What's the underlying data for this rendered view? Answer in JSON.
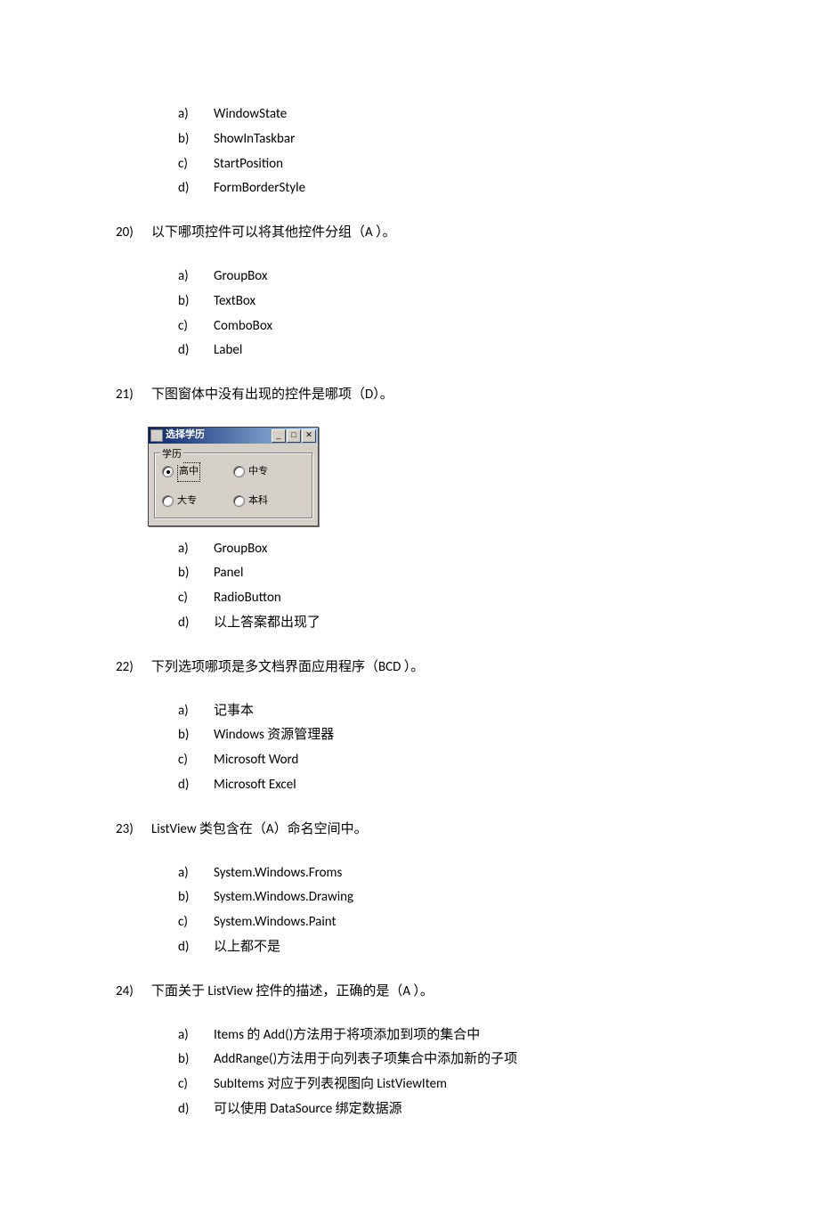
{
  "q19": {
    "options": [
      {
        "letter": "a)",
        "text": "WindowState"
      },
      {
        "letter": "b)",
        "text": "ShowInTaskbar"
      },
      {
        "letter": "c)",
        "text": "StartPosition"
      },
      {
        "letter": "d)",
        "text": "FormBorderStyle"
      }
    ]
  },
  "q20": {
    "num": "20)",
    "text": "以下哪项控件可以将其他控件分组（A   ）。",
    "options": [
      {
        "letter": "a)",
        "text": "GroupBox"
      },
      {
        "letter": "b)",
        "text": "TextBox"
      },
      {
        "letter": "c)",
        "text": "ComboBox"
      },
      {
        "letter": "d)",
        "text": "Label"
      }
    ]
  },
  "q21": {
    "num": "21)",
    "text": "下图窗体中没有出现的控件是哪项（D）。",
    "dialog": {
      "title": "选择学历",
      "groupbox_title": "学历",
      "radios": [
        {
          "label": "高中",
          "checked": true
        },
        {
          "label": "中专",
          "checked": false
        },
        {
          "label": "大专",
          "checked": false
        },
        {
          "label": "本科",
          "checked": false
        }
      ]
    },
    "options": [
      {
        "letter": "a)",
        "text": "GroupBox"
      },
      {
        "letter": "b)",
        "text": "Panel"
      },
      {
        "letter": "c)",
        "text": "RadioButton"
      },
      {
        "letter": "d)",
        "text": "以上答案都出现了"
      }
    ]
  },
  "q22": {
    "num": "22)",
    "text": "下列选项哪项是多文档界面应用程序（BCD   ）。",
    "options": [
      {
        "letter": "a)",
        "text": "记事本"
      },
      {
        "letter": "b)",
        "text": "Windows 资源管理器"
      },
      {
        "letter": "c)",
        "text": "Microsoft Word"
      },
      {
        "letter": "d)",
        "text": "Microsoft Excel"
      }
    ]
  },
  "q23": {
    "num": "23)",
    "text": "ListView 类包含在（A）命名空间中。",
    "options": [
      {
        "letter": "a)",
        "text": "System.Windows.Froms"
      },
      {
        "letter": "b)",
        "text": "System.Windows.Drawing"
      },
      {
        "letter": "c)",
        "text": "System.Windows.Paint"
      },
      {
        "letter": "d)",
        "text": "以上都不是"
      }
    ]
  },
  "q24": {
    "num": "24)",
    "text": "下面关于 ListView 控件的描述，正确的是（A  ）。",
    "options": [
      {
        "letter": "a)",
        "text": "Items 的 Add()方法用于将项添加到项的集合中"
      },
      {
        "letter": "b)",
        "text": "AddRange()方法用于向列表子项集合中添加新的子项"
      },
      {
        "letter": "c)",
        "text": "SubItems 对应于列表视图向 ListViewItem"
      },
      {
        "letter": "d)",
        "text": "可以使用 DataSource 绑定数据源"
      }
    ]
  }
}
